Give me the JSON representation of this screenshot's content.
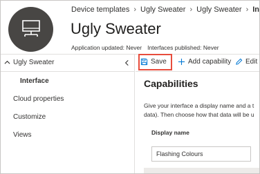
{
  "breadcrumb": {
    "items": [
      "Device templates",
      "Ugly Sweater",
      "Ugly Sweater"
    ],
    "current": "Interface"
  },
  "header": {
    "title": "Ugly Sweater",
    "meta": {
      "updated": "Application updated: Never",
      "published": "Interfaces published: Never"
    }
  },
  "sidebar": {
    "root_label": "Ugly Sweater",
    "items": [
      "Interface",
      "Cloud properties",
      "Customize",
      "Views"
    ]
  },
  "toolbar": {
    "save_label": "Save",
    "add_label": "Add capability",
    "edit_label": "Edit i"
  },
  "main": {
    "section_title": "Capabilities",
    "description_line1": "Give your interface a display name and a t",
    "description_line2": "data). Then choose how that data will be u",
    "field_label": "Display name",
    "field_value": "Flashing Colours"
  },
  "colors": {
    "avatar_bg": "#484644",
    "accent": "#0078d4",
    "highlight_border": "#e74c3c"
  },
  "icons": [
    "device-template-icon",
    "chevron-right-icon",
    "chevron-up-icon",
    "chevron-left-icon",
    "save-icon",
    "plus-icon",
    "edit-icon"
  ]
}
